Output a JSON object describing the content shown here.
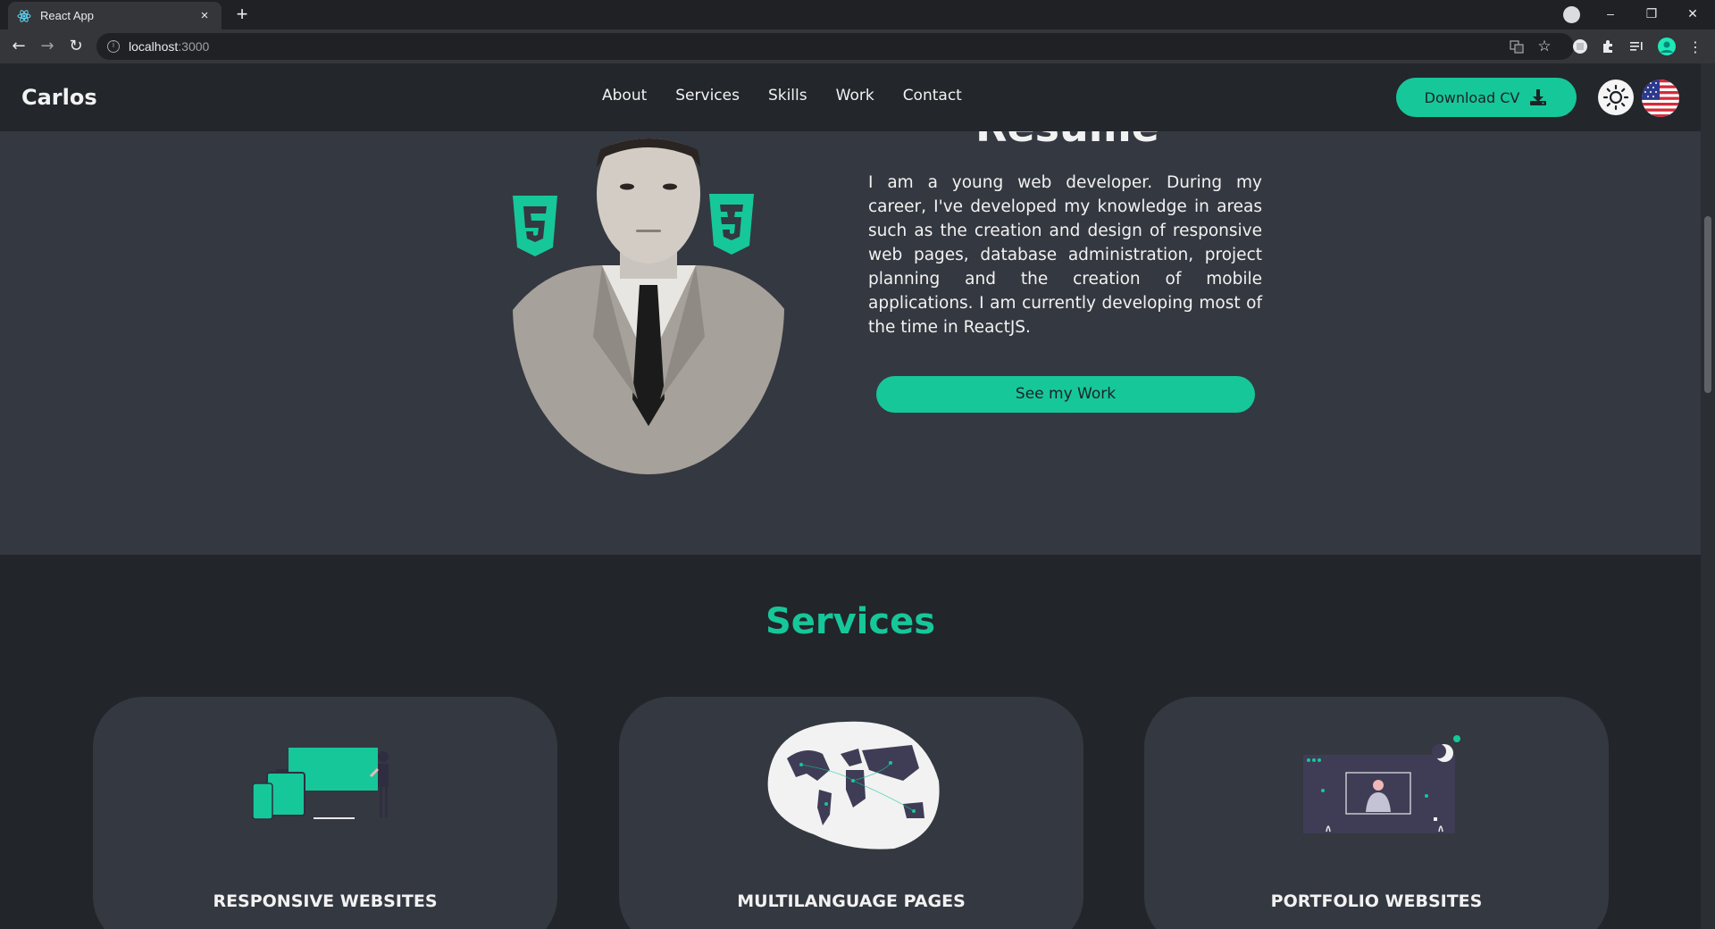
{
  "browser": {
    "tab_title": "React App",
    "tab_close": "×",
    "new_tab": "+",
    "url_host": "localhost",
    "url_port": ":3000",
    "window_controls": [
      "–",
      "❐",
      "✕"
    ]
  },
  "nav": {
    "logo": "Carlos",
    "links": [
      "About",
      "Services",
      "Skills",
      "Work",
      "Contact"
    ],
    "download_label": "Download CV",
    "theme_icon": "sun-icon",
    "language_icon": "us-flag-icon"
  },
  "resume": {
    "title": "Resume",
    "description": "I am a young web developer. During my career, I've developed my knowledge in areas such as the creation and design of responsive web pages, database administration, project planning and the creation of mobile applications. I am currently developing most of the time in ReactJS.",
    "button_label": "See my Work",
    "badges": [
      "html5-icon",
      "css3-icon"
    ]
  },
  "services": {
    "title": "Services",
    "cards": [
      {
        "title": "RESPONSIVE WEBSITES",
        "icon": "responsive-devices-illustration"
      },
      {
        "title": "MULTILANGUAGE PAGES",
        "icon": "world-map-illustration"
      },
      {
        "title": "PORTFOLIO WEBSITES",
        "icon": "portfolio-illustration"
      }
    ]
  },
  "colors": {
    "accent": "#16c79a",
    "background": "#22252a",
    "section": "#343840"
  }
}
